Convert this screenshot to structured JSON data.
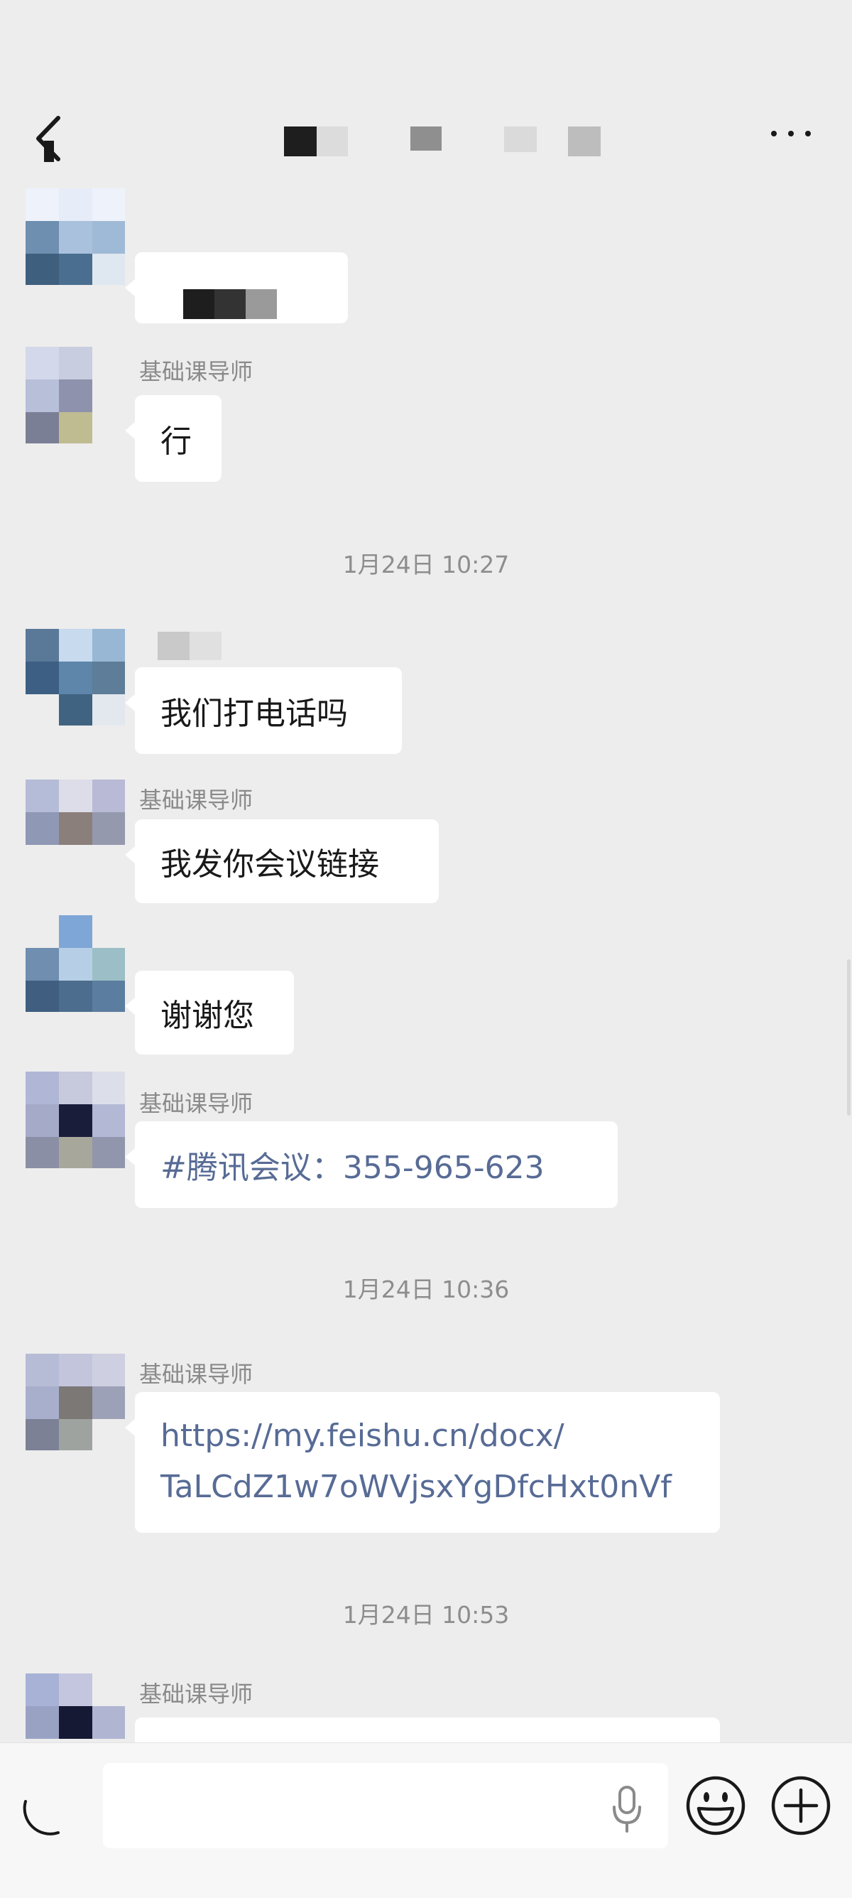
{
  "header": {
    "back_icon": "back-arrow-icon",
    "more_icon": "more-horizontal-icon"
  },
  "messages": [
    {
      "sender": "",
      "text": ""
    },
    {
      "sender": "基础课导师",
      "text": "行"
    },
    {
      "timestamp": "1月24日 10:27"
    },
    {
      "sender": "",
      "text": "我们打电话吗"
    },
    {
      "sender": "基础课导师",
      "text": "我发你会议链接"
    },
    {
      "sender": "",
      "text": "谢谢您"
    },
    {
      "sender": "基础课导师",
      "text": "#腾讯会议：355-965-623"
    },
    {
      "timestamp": "1月24日 10:36"
    },
    {
      "sender": "基础课导师",
      "text_line1": "https://my.feishu.cn/docx/",
      "text_line2": "TaLCdZ1w7oWVjsxYgDfcHxt0nVf"
    },
    {
      "timestamp": "1月24日 10:53"
    },
    {
      "sender": "基础课导师",
      "text": ""
    }
  ],
  "bottom_bar": {
    "voice_icon": "voice-toggle-icon",
    "input_value": "",
    "mic_icon": "microphone-icon",
    "emoji_icon": "emoji-icon",
    "plus_icon": "plus-circle-icon"
  },
  "colors": {
    "background": "#ededed",
    "bubble": "#ffffff",
    "link": "#576b95",
    "sender": "#8a8a8a",
    "timestamp": "#8d8d8d"
  }
}
